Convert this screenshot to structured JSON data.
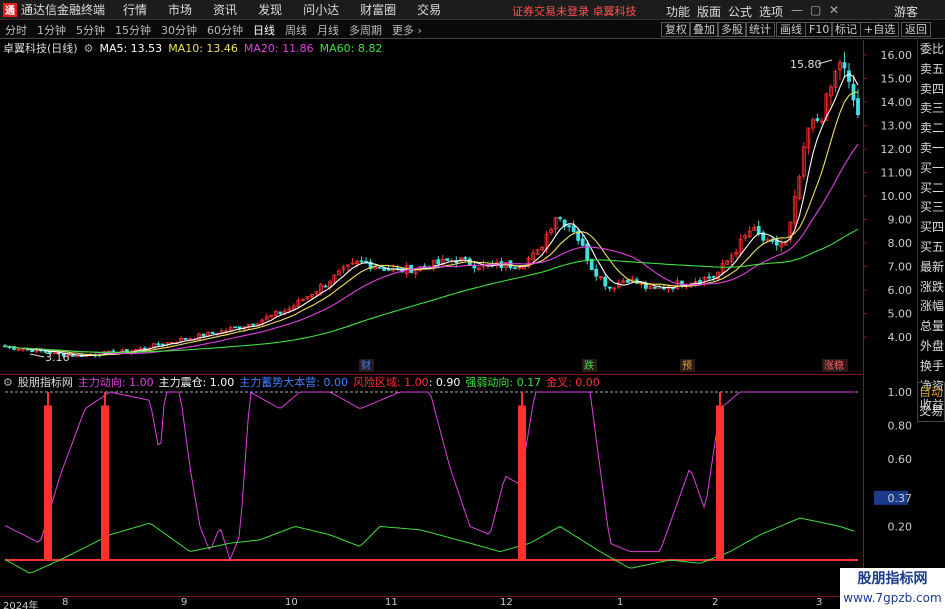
{
  "app": {
    "title": "通达信金融终端",
    "logo_text": "通",
    "menus": [
      "行情",
      "市场",
      "资讯",
      "发现",
      "问小达",
      "财富圈",
      "交易"
    ],
    "notice": "证券交易未登录  卓翼科技",
    "right_menus": [
      "功能",
      "版面",
      "公式",
      "选项"
    ],
    "guest": "游客",
    "window_controls": [
      "—",
      "▢",
      "✕"
    ]
  },
  "toolbar": {
    "periods": [
      "分时",
      "1分钟",
      "5分钟",
      "15分钟",
      "30分钟",
      "60分钟",
      "日线",
      "周线",
      "月线",
      "多周期",
      "更多 ›"
    ],
    "active": "日线",
    "right_buttons": [
      "复权",
      "叠加",
      "多股",
      "统计",
      "画线",
      "F10",
      "标记",
      "+自选",
      "返回"
    ]
  },
  "ma_bar": {
    "name": "卓翼科技(日线)",
    "items": [
      {
        "label": "MA5: 13.53",
        "color": "#ffffff"
      },
      {
        "label": "MA10: 13.46",
        "color": "#f0e060"
      },
      {
        "label": "MA20: 11.86",
        "color": "#e040e0"
      },
      {
        "label": "MA60: 8.82",
        "color": "#40e040"
      }
    ]
  },
  "price_axis": [
    "16.00",
    "15.00",
    "14.00",
    "13.00",
    "12.00",
    "11.00",
    "10.00",
    "9.00",
    "8.00",
    "7.00",
    "6.00",
    "5.00",
    "4.00"
  ],
  "side_panel": [
    "委比",
    "卖五",
    "卖四",
    "卖三",
    "卖二",
    "卖一",
    "买一",
    "买二",
    "买三",
    "买四",
    "买五",
    "最新",
    "涨跌",
    "涨幅",
    "总量",
    "外盘",
    "换手",
    "净资",
    "收益"
  ],
  "auto_trade": [
    "自动",
    "交易"
  ],
  "chart_annotations": {
    "high_label": "15.80",
    "low_label": "3.16",
    "events": [
      {
        "label": "财",
        "color": "#4080ff"
      },
      {
        "label": "跌",
        "color": "#40e040"
      },
      {
        "label": "预",
        "color": "#e0a030"
      },
      {
        "label": "涨稳",
        "color": "#ff6060"
      }
    ]
  },
  "indicator": {
    "name": "股朋指标网",
    "items": [
      {
        "label": "主力动向: 1.00",
        "color": "#e040e0"
      },
      {
        "label": "主力震仓: 1.00",
        "color": "#ffffff"
      },
      {
        "label": "主力蓄势大本营: 0.00",
        "color": "#4080ff"
      },
      {
        "label": "风险区域: 1.00",
        "color": "#ff3030"
      },
      {
        "label": ": 0.90",
        "color": "#ffffff"
      },
      {
        "label": "强弱动向: 0.17",
        "color": "#40e040"
      },
      {
        "label": "金叉: 0.00",
        "color": "#ff3030"
      }
    ],
    "axis": [
      "1.00",
      "0.80",
      "0.60",
      "0.37",
      "0.20"
    ]
  },
  "date_axis": [
    "2024年",
    "8",
    "9",
    "10",
    "11",
    "12",
    "1",
    "2",
    "3"
  ],
  "watermark": {
    "line1": "股朋指标网",
    "line2": "www.7gpzb.com"
  },
  "colors": {
    "up": "#ff3030",
    "down": "#40e0e0",
    "ma5": "#ffffff",
    "ma10": "#f0e060",
    "ma20": "#e040e0",
    "ma60": "#40e040",
    "axis": "#7a1a1a"
  }
}
